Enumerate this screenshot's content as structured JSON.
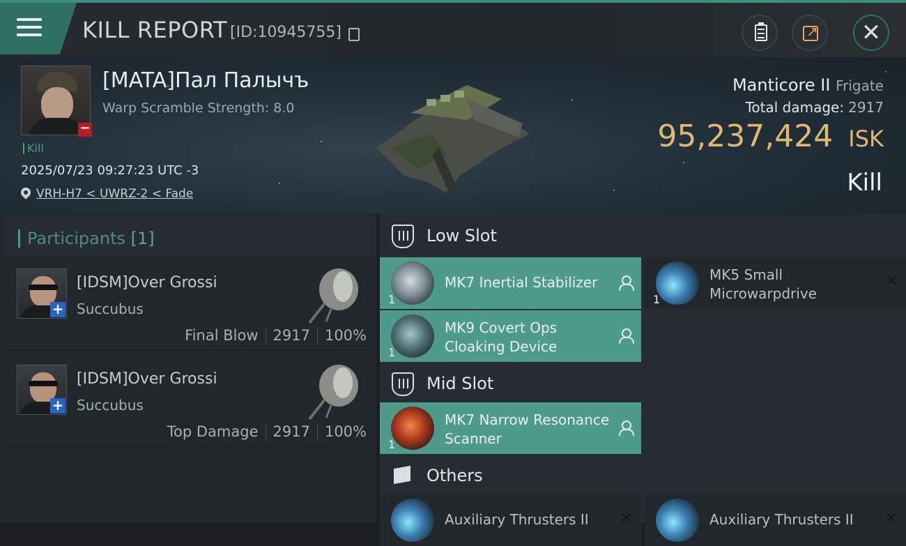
{
  "header": {
    "title": "KILL REPORT",
    "report_id": "[ID:10945755]",
    "icons": [
      "menu-icon",
      "copy-icon",
      "clipboard-icon",
      "share-icon",
      "close-icon"
    ]
  },
  "victim": {
    "name": "[MATA]Пал Палычъ",
    "subtitle": "Warp Scramble Strength: 8.0",
    "kill_tag": "Kill",
    "datetime": "2025/07/23 09:27:23 UTC -3",
    "location": "VRH-H7 < UWRZ-2 < Fade",
    "ship_name": "Manticore II",
    "ship_class": "Frigate",
    "total_damage_label": "Total damage:",
    "total_damage": "2917",
    "isk_value": "95,237,424",
    "isk_unit": "ISK",
    "result": "Kill"
  },
  "participants": {
    "label": "Participants",
    "count": "[1]",
    "rows": [
      {
        "name": "[IDSM]Over Grossi",
        "ship": "Succubus",
        "role": "Final Blow",
        "damage": "2917",
        "percent": "100%"
      },
      {
        "name": "[IDSM]Over Grossi",
        "ship": "Succubus",
        "role": "Top Damage",
        "damage": "2917",
        "percent": "100%"
      }
    ]
  },
  "fitting": {
    "low_slot": {
      "title": "Low Slot",
      "items": [
        {
          "name": "MK7 Inertial Stabilizer",
          "qty": "1",
          "status": "fitted"
        },
        {
          "name": "MK5 Small Microwarpdrive",
          "qty": "1",
          "status": "dropped"
        },
        {
          "name": "MK9 Covert Ops Cloaking Device",
          "qty": "1",
          "status": "fitted"
        }
      ]
    },
    "mid_slot": {
      "title": "Mid Slot",
      "items": [
        {
          "name": "MK7 Narrow Resonance Scanner",
          "qty": "1",
          "status": "fitted"
        }
      ]
    },
    "others": {
      "title": "Others",
      "items": [
        {
          "name": "Auxiliary Thrusters II",
          "qty": "",
          "status": "dropped"
        },
        {
          "name": "Auxiliary Thrusters II",
          "qty": "",
          "status": "dropped"
        }
      ]
    }
  },
  "colors": {
    "accent_teal": "#4f9b8b",
    "isk_gold": "#e0b872",
    "loss_red": "#b31e23",
    "ally_blue": "#2a63c6"
  }
}
